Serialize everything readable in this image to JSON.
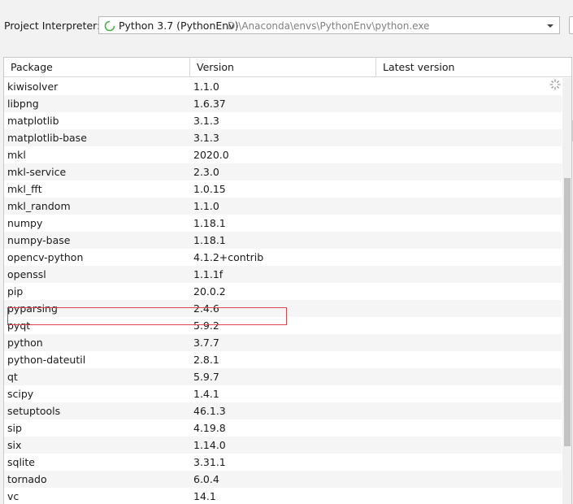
{
  "interpreter": {
    "label": "Project Interpreter:",
    "name": "Python 3.7 (PythonEnv)",
    "path": "D:\\Anaconda\\envs\\PythonEnv\\python.exe"
  },
  "table": {
    "headers": [
      "Package",
      "Version",
      "Latest version"
    ],
    "rows": [
      {
        "package": "kiwisolver",
        "version": "1.1.0",
        "latest": ""
      },
      {
        "package": "libpng",
        "version": "1.6.37",
        "latest": ""
      },
      {
        "package": "matplotlib",
        "version": "3.1.3",
        "latest": ""
      },
      {
        "package": "matplotlib-base",
        "version": "3.1.3",
        "latest": ""
      },
      {
        "package": "mkl",
        "version": "2020.0",
        "latest": ""
      },
      {
        "package": "mkl-service",
        "version": "2.3.0",
        "latest": ""
      },
      {
        "package": "mkl_fft",
        "version": "1.0.15",
        "latest": ""
      },
      {
        "package": "mkl_random",
        "version": "1.1.0",
        "latest": ""
      },
      {
        "package": "numpy",
        "version": "1.18.1",
        "latest": ""
      },
      {
        "package": "numpy-base",
        "version": "1.18.1",
        "latest": ""
      },
      {
        "package": "opencv-python",
        "version": "4.1.2+contrib",
        "latest": ""
      },
      {
        "package": "openssl",
        "version": "1.1.1f",
        "latest": ""
      },
      {
        "package": "pip",
        "version": "20.0.2",
        "latest": ""
      },
      {
        "package": "pyparsing",
        "version": "2.4.6",
        "latest": ""
      },
      {
        "package": "pyqt",
        "version": "5.9.2",
        "latest": ""
      },
      {
        "package": "python",
        "version": "3.7.7",
        "latest": ""
      },
      {
        "package": "python-dateutil",
        "version": "2.8.1",
        "latest": ""
      },
      {
        "package": "qt",
        "version": "5.9.7",
        "latest": ""
      },
      {
        "package": "scipy",
        "version": "1.4.1",
        "latest": ""
      },
      {
        "package": "setuptools",
        "version": "46.1.3",
        "latest": ""
      },
      {
        "package": "sip",
        "version": "4.19.8",
        "latest": ""
      },
      {
        "package": "six",
        "version": "1.14.0",
        "latest": ""
      },
      {
        "package": "sqlite",
        "version": "3.31.1",
        "latest": ""
      },
      {
        "package": "tornado",
        "version": "6.0.4",
        "latest": ""
      },
      {
        "package": "vc",
        "version": "14.1",
        "latest": ""
      }
    ]
  },
  "highlight_color": "#d9464e",
  "icons": {
    "interpreter": "python-loading-icon",
    "dropdown": "chevron-down-icon",
    "status": "loading-spinner-icon"
  }
}
